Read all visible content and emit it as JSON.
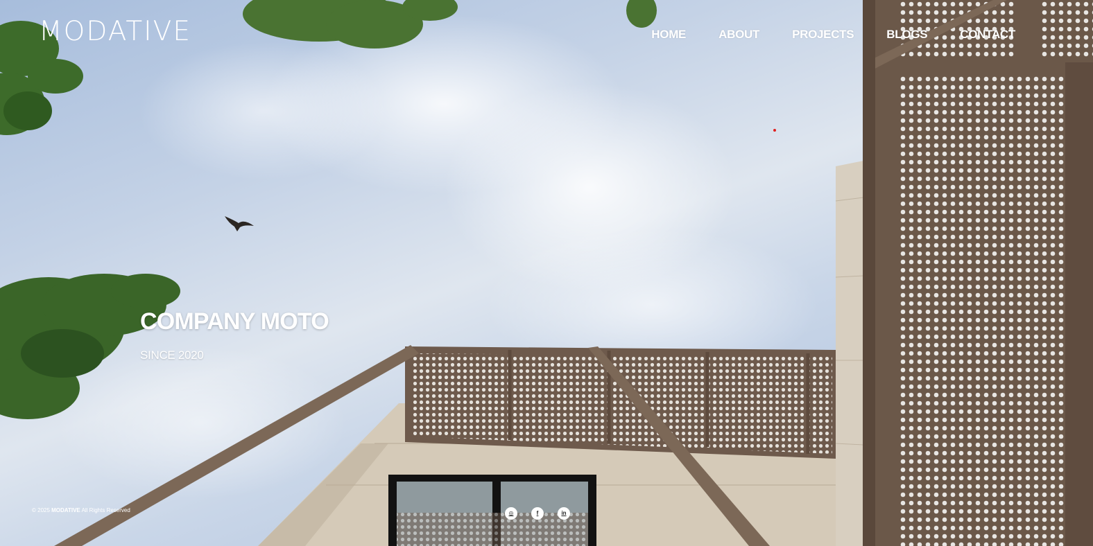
{
  "brand": {
    "logo_text": "MODATIVE"
  },
  "nav": {
    "items": [
      {
        "label": "HOME"
      },
      {
        "label": "ABOUT"
      },
      {
        "label": "PROJECTS"
      },
      {
        "label": "BLOGS"
      },
      {
        "label": "CONTACT"
      }
    ]
  },
  "hero": {
    "title": "COMPANY MOTO",
    "subtitle": "SINCE 2020"
  },
  "footer": {
    "copyright_prefix": "© 2025 ",
    "copyright_brand": "MODATIVE",
    "copyright_suffix": " All Rights Reserved",
    "socials": [
      {
        "icon": "instagram-icon",
        "glyph": "◎"
      },
      {
        "icon": "facebook-icon",
        "glyph": "f"
      },
      {
        "icon": "linkedin-icon",
        "glyph": "in"
      }
    ]
  },
  "colors": {
    "text": "#ffffff",
    "sky": "#c4d2e6",
    "facade": "#6e5a4c",
    "stone": "#d3c7b5",
    "foliage": "#3d6b2a",
    "accent_dot": "#e02020"
  }
}
